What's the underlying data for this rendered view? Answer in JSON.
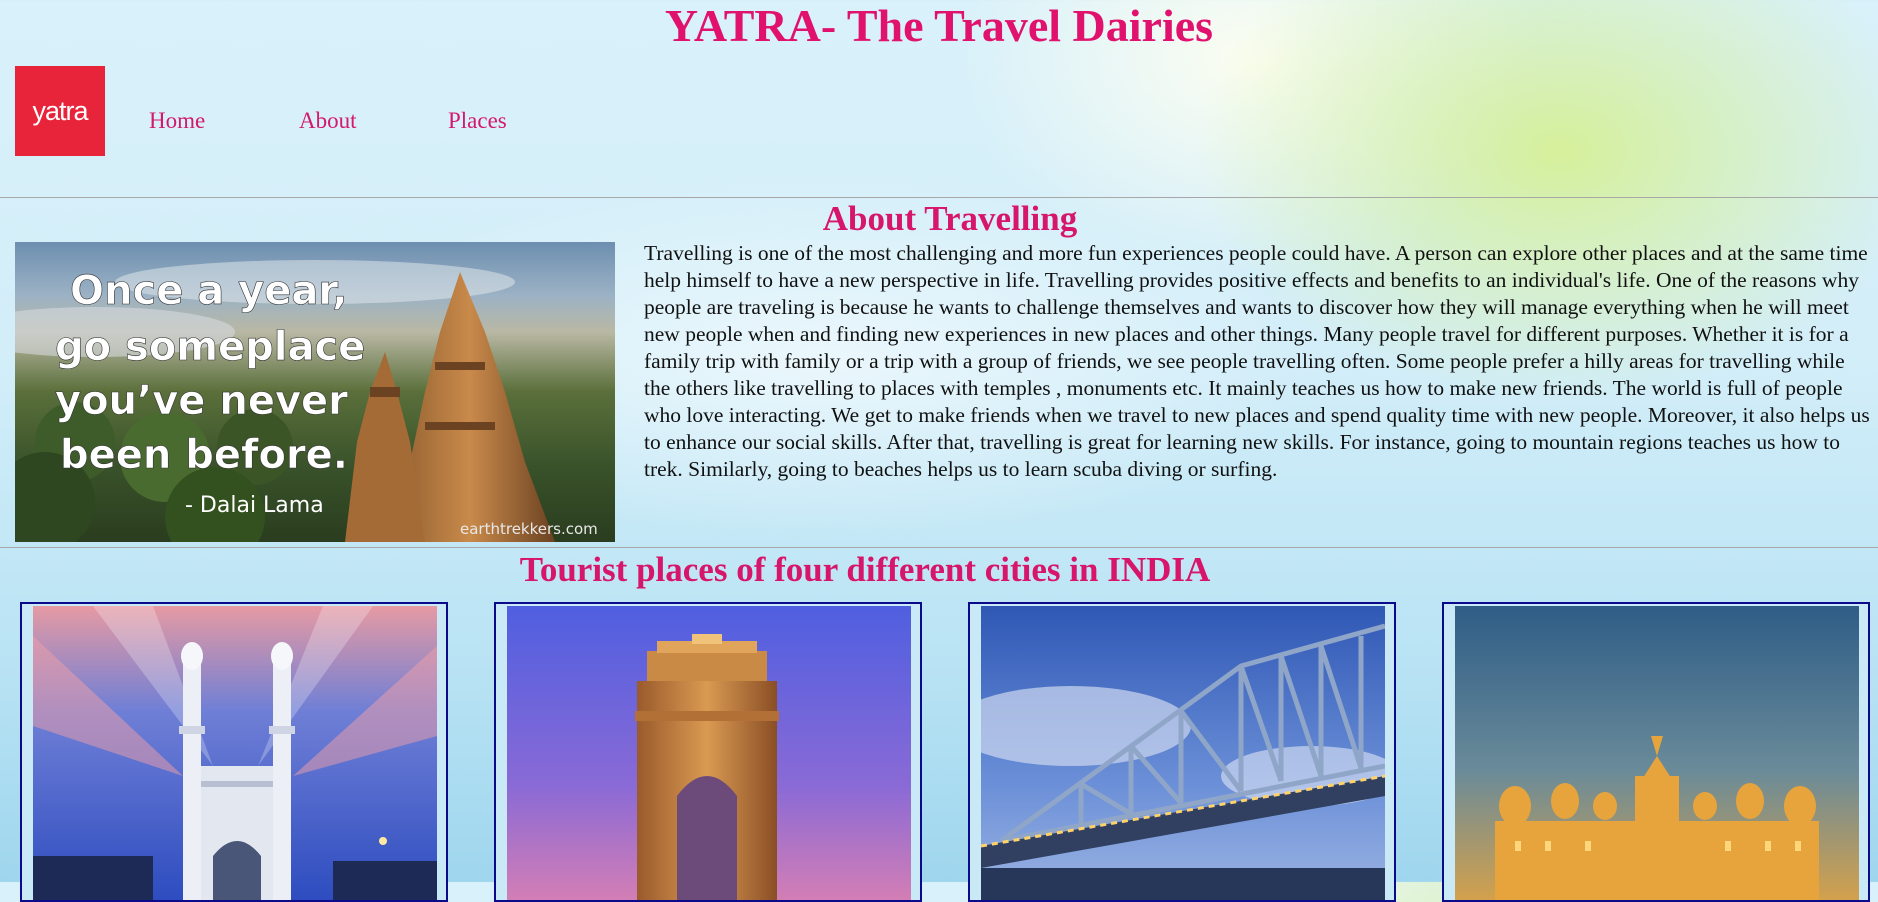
{
  "header": {
    "title": "YATRA- The Travel Dairies"
  },
  "logo": {
    "text": "yatra",
    "color": "#e8243a"
  },
  "nav": {
    "items": [
      "Home",
      "About",
      "Places"
    ]
  },
  "about": {
    "heading": "About Travelling",
    "image": {
      "lines": [
        "Once a year,",
        "go someplace",
        "you’ve never",
        "been before."
      ],
      "attribution": "- Dalai Lama",
      "watermark": "earthtrekkers.com"
    },
    "paragraph": "Travelling is one of the most challenging and more fun experiences people could have. A person can explore other places and at the same time help himself to have a new perspective in life. Travelling provides positive effects and benefits to an individual's life. One of the reasons why people are traveling is because he wants to challenge themselves and wants to discover how they will manage everything when he will meet new people when and finding new experiences in new places and other things. Many people travel for different purposes. Whether it is for a family trip with family or a trip with a group of friends, we see people travelling often. Some people prefer a hilly areas for travelling while the others like travelling to places with temples , monuments etc. It mainly teaches us how to make new friends. The world is full of people who love interacting. We get to make friends when we travel to new places and spend quality time with new people. Moreover, it also helps us to enhance our social skills. After that, travelling is great for learning new skills. For instance, going to mountain regions teaches us how to trek. Similarly, going to beaches helps us to learn scuba diving or surfing."
  },
  "places": {
    "heading": "Tourist places of four different cities in INDIA",
    "cards": [
      {
        "icon": "charminar-photo-icon"
      },
      {
        "icon": "india-gate-photo-icon"
      },
      {
        "icon": "howrah-bridge-photo-icon"
      },
      {
        "icon": "mysore-palace-photo-icon"
      }
    ]
  },
  "colors": {
    "accent": "#e0126e",
    "card_border": "#0a0a8a"
  }
}
